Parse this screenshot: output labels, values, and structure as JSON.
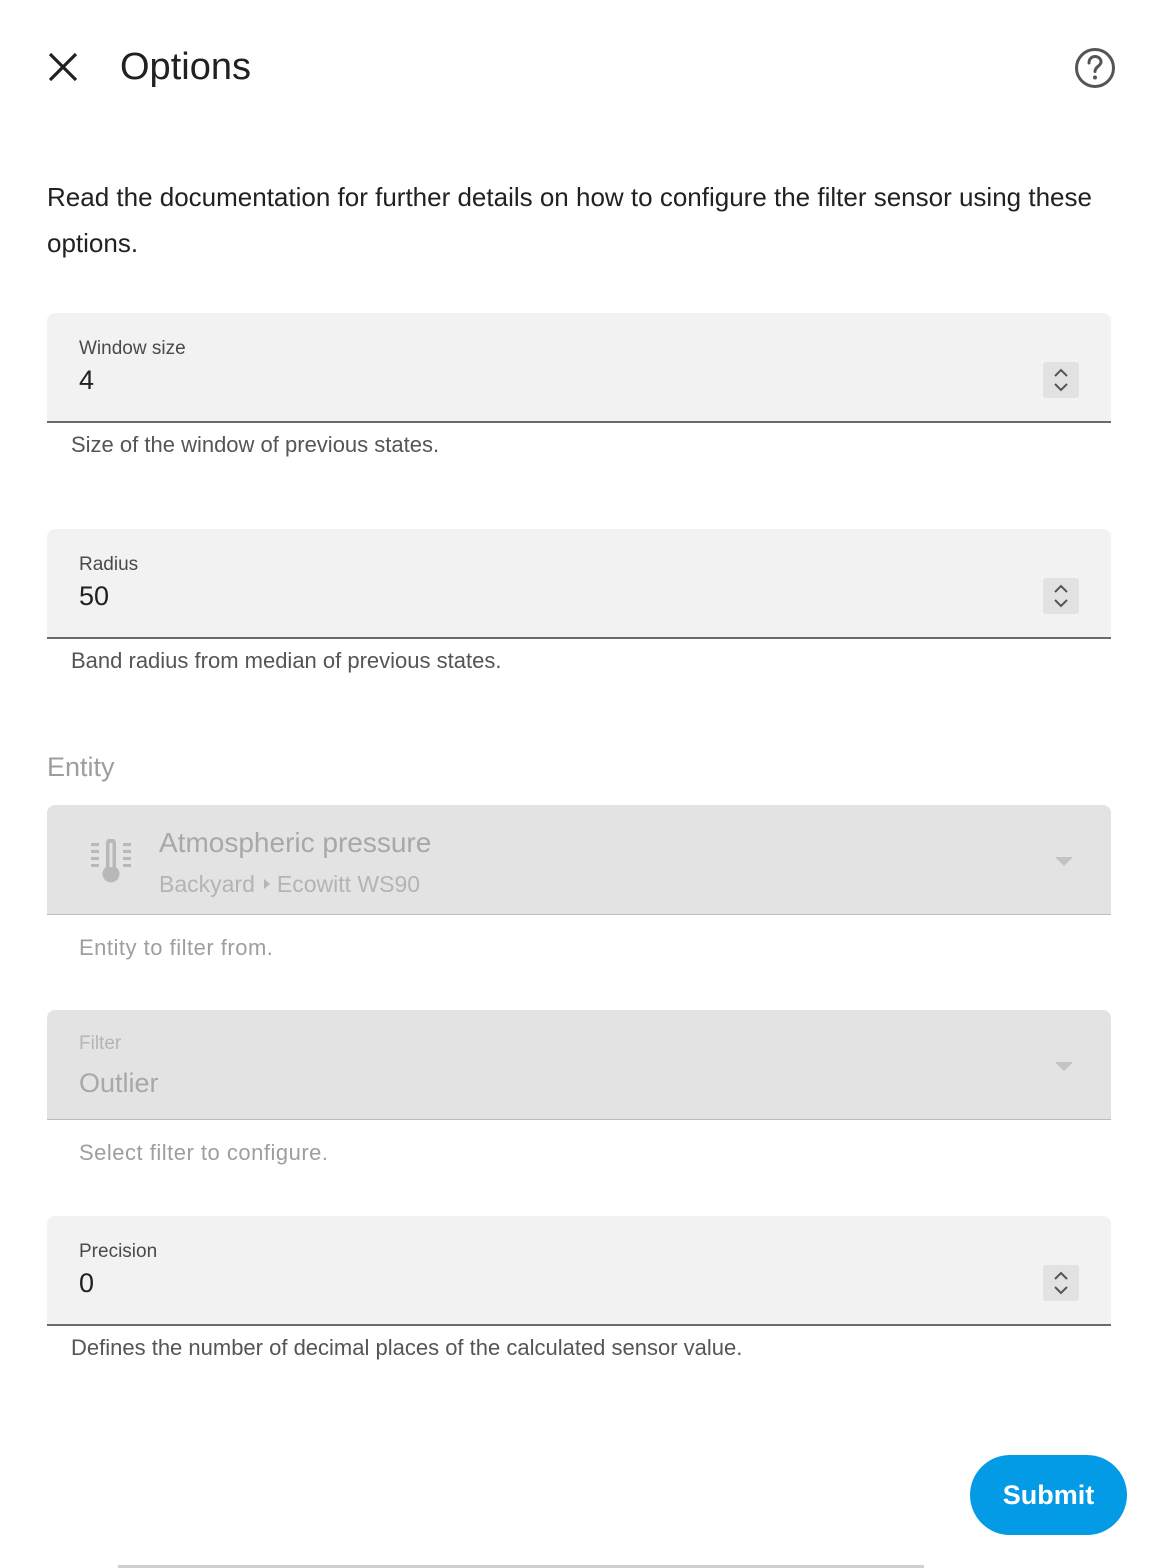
{
  "header": {
    "title": "Options"
  },
  "description": "Read the documentation for further details on how to configure the filter sensor using these options.",
  "fields": {
    "window_size": {
      "label": "Window size",
      "value": "4",
      "helper": "Size of the window of previous states."
    },
    "radius": {
      "label": "Radius",
      "value": "50",
      "helper": "Band radius from median of previous states."
    },
    "precision": {
      "label": "Precision",
      "value": "0",
      "helper": "Defines the number of decimal places of the calculated sensor value."
    }
  },
  "entity": {
    "section_label": "Entity",
    "name": "Atmospheric pressure",
    "area": "Backyard",
    "device": "Ecowitt WS90",
    "icon": "thermometer-icon",
    "helper": "Entity to filter from."
  },
  "filter": {
    "label": "Filter",
    "value": "Outlier",
    "helper": "Select filter to configure."
  },
  "actions": {
    "submit_label": "Submit"
  },
  "colors": {
    "accent": "#039be5",
    "field_bg": "#f2f2f2",
    "field_disabled_bg": "#e3e3e3"
  }
}
